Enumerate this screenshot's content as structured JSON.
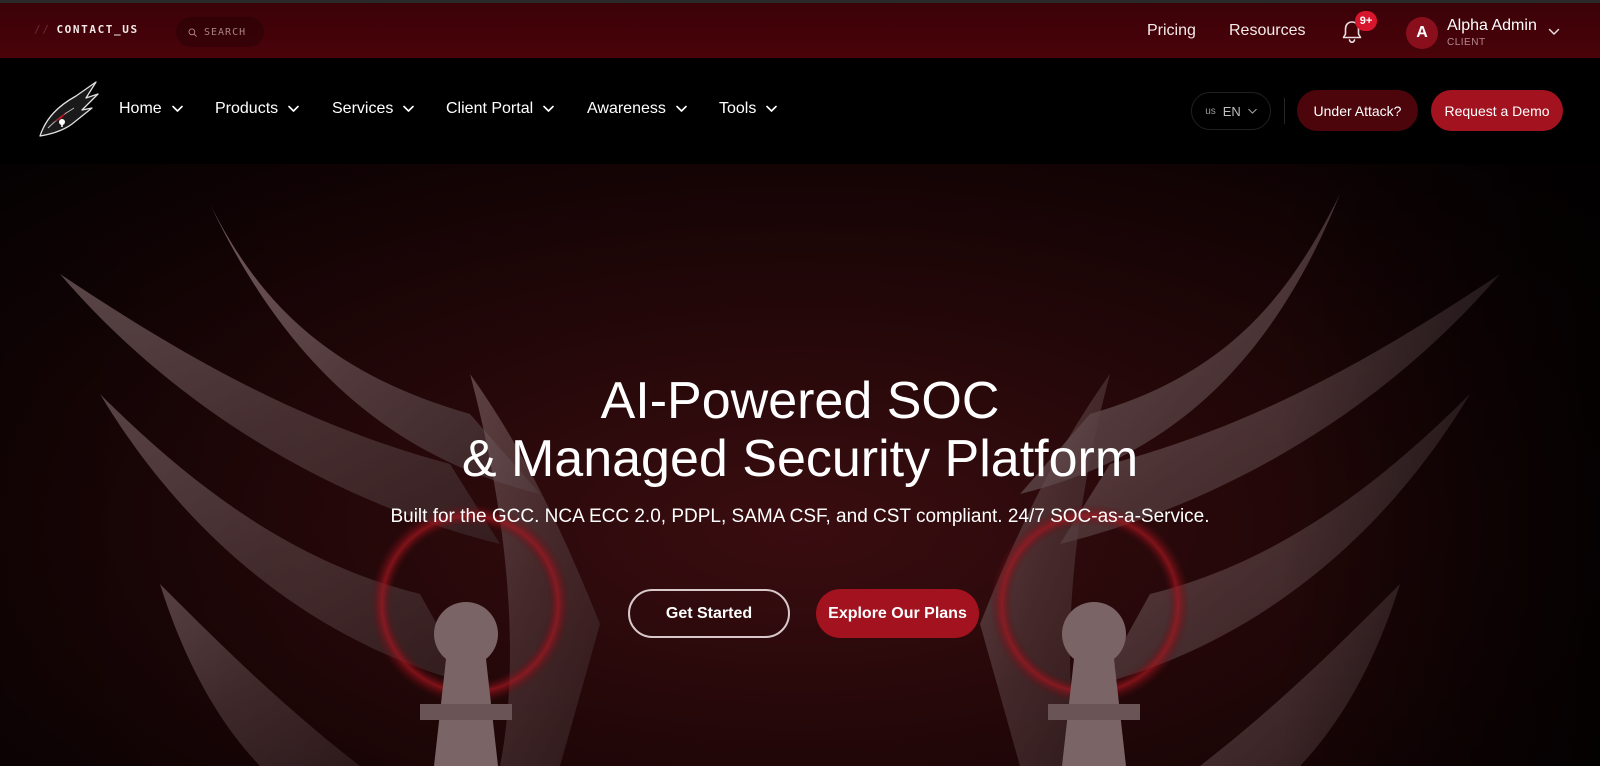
{
  "topbar": {
    "contact_prefix": "//",
    "contact_label": "CONTACT_US",
    "search_placeholder": "SEARCH",
    "links": [
      "Pricing",
      "Resources"
    ],
    "notification_badge": "9+",
    "user": {
      "initial": "A",
      "name": "Alpha Admin",
      "role": "CLIENT"
    }
  },
  "nav": {
    "items": [
      "Home",
      "Products",
      "Services",
      "Client Portal",
      "Awareness",
      "Tools"
    ],
    "language": {
      "flag": "us",
      "code": "EN"
    },
    "under_attack_label": "Under Attack?",
    "request_demo_label": "Request a Demo"
  },
  "hero": {
    "title_line1": "AI-Powered SOC",
    "title_line2": "& Managed Security Platform",
    "subtitle": "Built for the GCC. NCA ECC 2.0, PDPL, SAMA CSF, and CST compliant. 24/7 SOC-as-a-Service.",
    "primary_cta": "Get Started",
    "secondary_cta": "Explore Our Plans"
  },
  "icons": {
    "search": "search-icon",
    "bell": "bell-icon",
    "chevron": "chevron-down-icon",
    "logo": "dragon-logo"
  },
  "colors": {
    "topbar_bg": "#4a0309",
    "accent_red": "#a3121f",
    "dark_red": "#4d050c",
    "badge_red": "#d6162c",
    "nav_bg": "#000000"
  }
}
